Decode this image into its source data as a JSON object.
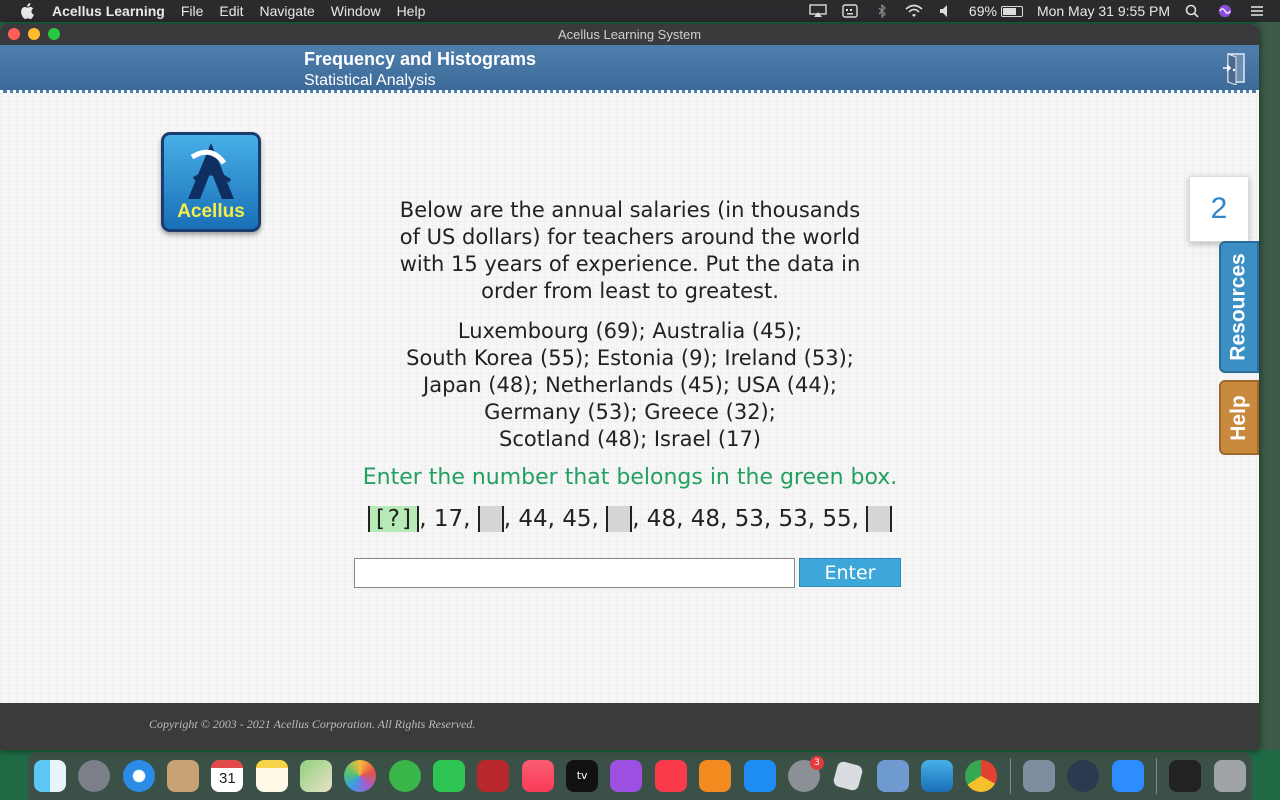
{
  "menubar": {
    "app_name": "Acellus Learning",
    "menus": [
      "File",
      "Edit",
      "Navigate",
      "Window",
      "Help"
    ],
    "battery_percent": "69%",
    "datetime": "Mon May 31  9:55 PM"
  },
  "window": {
    "title": "Acellus Learning System"
  },
  "header": {
    "lesson_title": "Frequency and Histograms",
    "course_unit": "Statistical Analysis"
  },
  "logo": {
    "text": "Acellus"
  },
  "page_number": "2",
  "side_tabs": {
    "resources": "Resources",
    "help": "Help"
  },
  "question": {
    "prompt_lines": [
      "Below are the annual salaries (in thousands",
      "of US dollars) for teachers around the world",
      "with 15 years of experience. Put the data in",
      "order from least to greatest."
    ],
    "data_lines": [
      "Luxembourg (69);  Australia (45);",
      "South Korea (55);  Estonia (9);  Ireland (53);",
      "Japan (48);  Netherlands (45);  USA (44);",
      "Germany (53);  Greece (32);",
      "Scotland (48);  Israel (17)"
    ],
    "instruction": "Enter the number that belongs in the green box.",
    "sequence": {
      "green_box": "[?]",
      "parts": [
        ", 17, ",
        ", 44, 45, ",
        ", 48, 48, 53, 53, 55, "
      ]
    }
  },
  "answer": {
    "value": "",
    "enter_label": "Enter"
  },
  "footer": {
    "copyright": "Copyright © 2003 - 2021 Acellus Corporation.  All Rights Reserved."
  },
  "dock": {
    "calendar_day": "31",
    "settings_badge": "3",
    "apps": [
      "finder-icon",
      "launchpad-icon",
      "safari-icon",
      "contacts-icon",
      "calendar-icon",
      "notes-icon",
      "maps-icon",
      "photos-icon",
      "messages-icon",
      "facetime-icon",
      "photo-booth-icon",
      "music-icon",
      "tv-icon",
      "podcasts-icon",
      "news-icon",
      "books-icon",
      "app-store-icon",
      "system-preferences-icon",
      "roblox-icon",
      "preview-icon",
      "acellus-icon",
      "chrome-icon",
      "image-capture-icon",
      "quicktime-icon",
      "zoom-icon",
      "terminal-icon",
      "trash-icon"
    ]
  },
  "colors": {
    "header_blue": "#3d6a98",
    "instruction_green": "#22a060",
    "enter_button": "#3ea7da",
    "resources_tab": "#3a8fc4",
    "help_tab": "#c98a3e"
  }
}
